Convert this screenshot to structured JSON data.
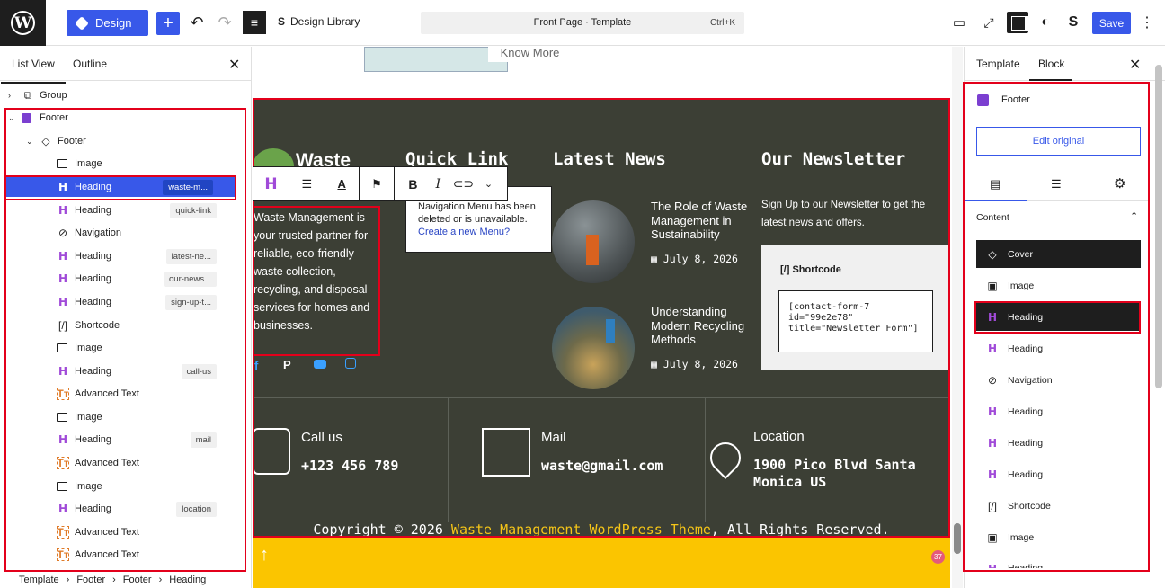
{
  "topbar": {
    "design_label": "Design",
    "design_library_label": "Design Library",
    "command": "Front Page · Template",
    "command_shortcut": "Ctrl+K",
    "save_label": "Save"
  },
  "left_panel": {
    "tab_list_view": "List View",
    "tab_outline": "Outline",
    "tree": [
      {
        "label": "Group",
        "icon": "group-icon",
        "tag": ""
      },
      {
        "label": "Footer",
        "icon": "template-part-icon",
        "tag": ""
      },
      {
        "label": "Footer",
        "icon": "cover-icon",
        "tag": ""
      },
      {
        "label": "Image",
        "icon": "image-icon",
        "tag": ""
      },
      {
        "label": "Heading",
        "icon": "heading-icon",
        "tag": "waste-m..."
      },
      {
        "label": "Heading",
        "icon": "heading-icon",
        "tag": "quick-link"
      },
      {
        "label": "Navigation",
        "icon": "navigation-icon",
        "tag": ""
      },
      {
        "label": "Heading",
        "icon": "heading-icon",
        "tag": "latest-ne..."
      },
      {
        "label": "Heading",
        "icon": "heading-icon",
        "tag": "our-news..."
      },
      {
        "label": "Heading",
        "icon": "heading-icon",
        "tag": "sign-up-t..."
      },
      {
        "label": "Shortcode",
        "icon": "shortcode-icon",
        "tag": ""
      },
      {
        "label": "Image",
        "icon": "image-icon",
        "tag": ""
      },
      {
        "label": "Heading",
        "icon": "heading-icon",
        "tag": "call-us"
      },
      {
        "label": "Advanced Text",
        "icon": "advanced-text-icon",
        "tag": ""
      },
      {
        "label": "Image",
        "icon": "image-icon",
        "tag": ""
      },
      {
        "label": "Heading",
        "icon": "heading-icon",
        "tag": "mail"
      },
      {
        "label": "Advanced Text",
        "icon": "advanced-text-icon",
        "tag": ""
      },
      {
        "label": "Image",
        "icon": "image-icon",
        "tag": ""
      },
      {
        "label": "Heading",
        "icon": "heading-icon",
        "tag": "location"
      },
      {
        "label": "Advanced Text",
        "icon": "advanced-text-icon",
        "tag": ""
      },
      {
        "label": "Advanced Text",
        "icon": "advanced-text-icon",
        "tag": ""
      }
    ]
  },
  "breadcrumbs": [
    "Template",
    "Footer",
    "Footer",
    "Heading"
  ],
  "canvas": {
    "know_more": "Know More",
    "logo_text": "Waste",
    "col_quick_link": "Quick Link",
    "col_latest_news": "Latest News",
    "col_newsletter": "Our Newsletter",
    "about_text": "Waste Management is your trusted partner for reliable, eco-friendly waste collection, recycling, and disposal services for homes and businesses.",
    "nav_notice": "Navigation Menu has been deleted or is unavailable.",
    "nav_link": "Create a new Menu?",
    "news": [
      {
        "title": "The Role of Waste Management in Sustainability",
        "date": "July 8, 2026"
      },
      {
        "title": "Understanding Modern Recycling Methods",
        "date": "July 8, 2026"
      }
    ],
    "newsletter_text": "Sign Up to our Newsletter to get the latest news and offers.",
    "shortcode_label": "Shortcode",
    "shortcode_value": "[contact-form-7 id=\"99e2e78\" title=\"Newsletter Form\"]",
    "call_label": "Call us",
    "call_value": "+123 456 789",
    "mail_label": "Mail",
    "mail_value": "waste@gmail.com",
    "location_label": "Location",
    "location_value": "1900 Pico Blvd Santa Monica US",
    "copyright_prefix": "Copyright © 2026 ",
    "copyright_link": "Waste Management WordPress Theme",
    "copyright_suffix": ", All Rights Reserved.",
    "badge": "37"
  },
  "right_panel": {
    "tab_template": "Template",
    "tab_block": "Block",
    "footer_label": "Footer",
    "edit_original": "Edit original",
    "content_label": "Content",
    "blocks": [
      {
        "label": "Cover",
        "icon": "cover-icon"
      },
      {
        "label": "Image",
        "icon": "image-icon"
      },
      {
        "label": "Heading",
        "icon": "heading-icon"
      },
      {
        "label": "Heading",
        "icon": "heading-icon"
      },
      {
        "label": "Navigation",
        "icon": "navigation-icon"
      },
      {
        "label": "Heading",
        "icon": "heading-icon"
      },
      {
        "label": "Heading",
        "icon": "heading-icon"
      },
      {
        "label": "Heading",
        "icon": "heading-icon"
      },
      {
        "label": "Shortcode",
        "icon": "shortcode-icon"
      },
      {
        "label": "Image",
        "icon": "image-icon"
      },
      {
        "label": "Heading",
        "icon": "heading-icon"
      }
    ]
  },
  "colors": {
    "accent": "#3858e9",
    "footer_bg": "#3c3f35",
    "highlight_red": "#e3001b",
    "copyright_link": "#f5c518",
    "bottom_bar": "#fbc500"
  }
}
